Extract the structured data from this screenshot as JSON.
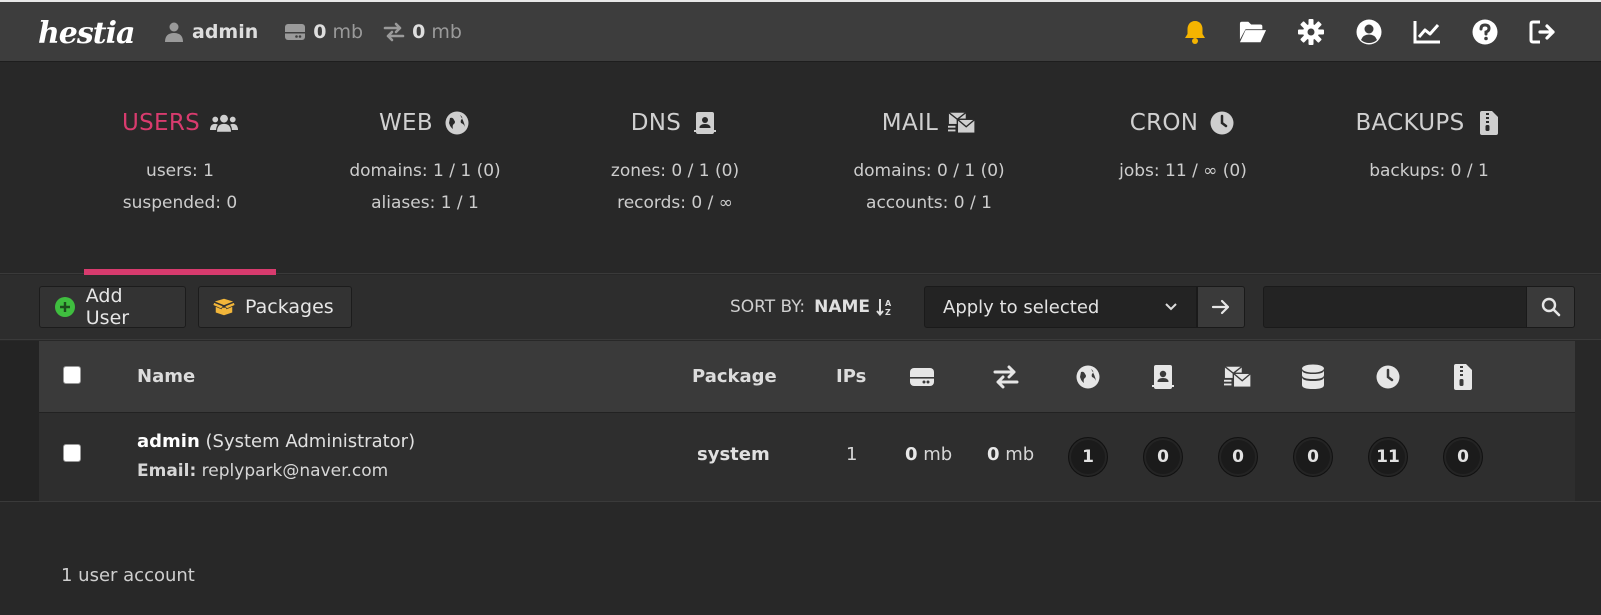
{
  "topbar": {
    "logo": "hestia",
    "user": "admin",
    "disk_value": "0",
    "disk_unit": "mb",
    "bandwidth_value": "0",
    "bandwidth_unit": "mb",
    "icons": [
      "bell-icon",
      "folder-open-icon",
      "gear-icon",
      "user-circle-icon",
      "chart-line-icon",
      "question-circle-icon",
      "sign-out-icon"
    ],
    "colors": {
      "bell": "#f5b400",
      "icons": "#ffffff"
    }
  },
  "tabs": [
    {
      "title": "USERS",
      "icon": "users-icon",
      "line1": "users: 1",
      "line2": "suspended: 0",
      "active": true
    },
    {
      "title": "WEB",
      "icon": "globe-icon",
      "line1": "domains: 1 / 1 (0)",
      "line2": "aliases: 1 / 1",
      "active": false
    },
    {
      "title": "DNS",
      "icon": "address-book-icon",
      "line1": "zones: 0 / 1 (0)",
      "line2": "records: 0 / ∞",
      "active": false
    },
    {
      "title": "MAIL",
      "icon": "mail-bulk-icon",
      "line1": "domains: 0 / 1 (0)",
      "line2": "accounts: 0 / 1",
      "active": false
    },
    {
      "title": "CRON",
      "icon": "clock-icon",
      "line1": "jobs: 11 / ∞ (0)",
      "line2": "",
      "active": false
    },
    {
      "title": "BACKUPS",
      "icon": "file-archive-icon",
      "line1": "backups: 0 / 1",
      "line2": "",
      "active": false
    }
  ],
  "accent_color": "#d83b6e",
  "toolbar": {
    "add_user_label": "Add User",
    "packages_label": "Packages",
    "sort_by_label": "SORT BY:",
    "sort_value": "NAME",
    "bulk_select_value": "Apply to selected",
    "search_placeholder": ""
  },
  "table": {
    "headers": {
      "name": "Name",
      "package": "Package",
      "ips": "IPs",
      "icon_columns": [
        "hdd-icon",
        "exchange-icon",
        "globe-icon",
        "address-book-icon",
        "mail-bulk-icon",
        "database-icon",
        "clock-icon",
        "file-archive-icon"
      ]
    },
    "rows": [
      {
        "username": "admin",
        "fullname": "(System Administrator)",
        "email_label": "Email:",
        "email": "replypark@naver.com",
        "package": "system",
        "ips": "1",
        "disk_value": "0",
        "disk_unit": "mb",
        "bandwidth_value": "0",
        "bandwidth_unit": "mb",
        "web": "1",
        "dns": "0",
        "mail": "0",
        "db": "0",
        "cron": "11",
        "backups": "0"
      }
    ]
  },
  "footer": {
    "count_text": "1 user account"
  }
}
